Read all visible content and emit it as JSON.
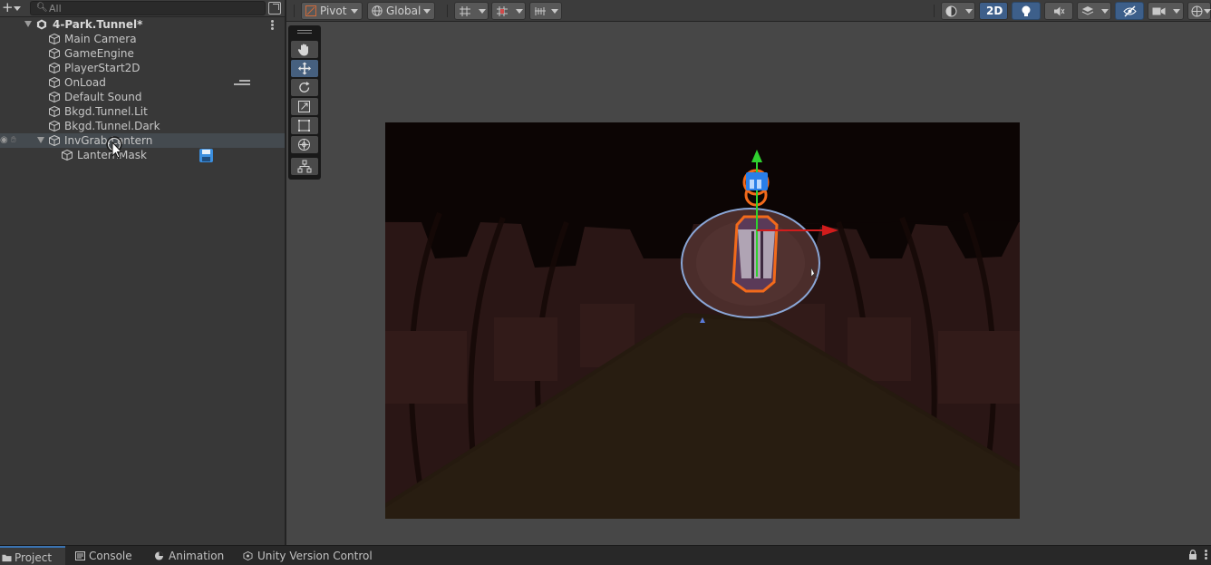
{
  "hierarchy": {
    "search": {
      "placeholder": "All"
    },
    "scene": {
      "name": "4-Park.Tunnel*"
    },
    "items": [
      {
        "label": "Main Camera"
      },
      {
        "label": "GameEngine"
      },
      {
        "label": "PlayerStart2D"
      },
      {
        "label": "OnLoad"
      },
      {
        "label": "Default Sound"
      },
      {
        "label": "Bkgd.Tunnel.Lit"
      },
      {
        "label": "Bkgd.Tunnel.Dark"
      },
      {
        "label": "InvGrab.Lantern"
      },
      {
        "label": "LanternMask"
      }
    ],
    "selected_item": "InvGrab.Lantern"
  },
  "scene_toolbar": {
    "pivot_label": "Pivot",
    "global_label": "Global",
    "mode_2d_label": "2D",
    "mode_2d_active": true,
    "lighting_active": true,
    "hidden_objects_toggle_active": true
  },
  "tool_palette": {
    "tools": [
      "hand-tool",
      "move-tool",
      "rotate-tool",
      "scale-tool",
      "rect-tool",
      "transform-tool",
      "custom-editor-tool"
    ],
    "active_tool": "move-tool"
  },
  "bottom_tabs": {
    "tabs": [
      {
        "label": "Project",
        "icon": "folder-icon",
        "active": true
      },
      {
        "label": "Console",
        "icon": "console-icon",
        "active": false
      },
      {
        "label": "Animation",
        "icon": "animation-icon",
        "active": false
      },
      {
        "label": "Unity Version Control",
        "icon": "version-control-icon",
        "active": false
      }
    ]
  },
  "colors": {
    "accent": "#3d5f8a",
    "selection_outline": "#f26a1b",
    "gizmo_y": "#2fd12f",
    "gizmo_x": "#d11c1c",
    "game_background": "#2a1615"
  }
}
